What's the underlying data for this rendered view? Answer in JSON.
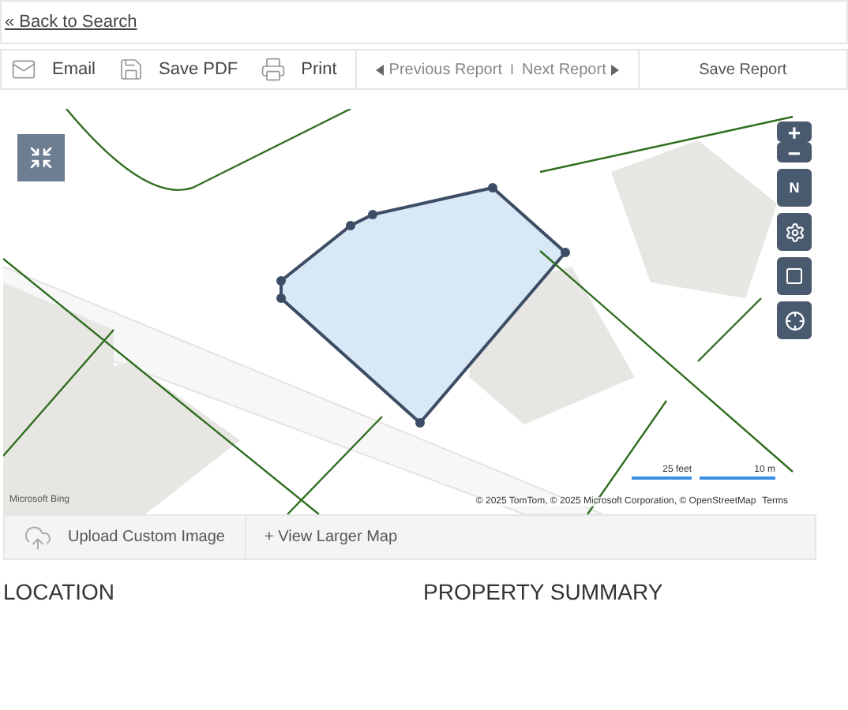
{
  "back_link": "« Back to Search",
  "toolbar": {
    "actions": [
      {
        "kind": "email",
        "label": "Email"
      },
      {
        "kind": "pdf",
        "label": "Save PDF"
      },
      {
        "kind": "print",
        "label": "Print"
      }
    ],
    "prev": "Previous Report",
    "separator": "I",
    "next": "Next Report",
    "save": "Save Report"
  },
  "map": {
    "kind": "picture",
    "bing": "Microsoft Bing",
    "attribution": "© 2025 TomTom, © 2025 Microsoft Corporation, © OpenStreetMap",
    "terms": "Terms",
    "scale": [
      "25 feet",
      "10 m"
    ],
    "controls": [
      {
        "kind": "zoom-in",
        "label": "+"
      },
      {
        "kind": "zoom-out",
        "label": "−"
      },
      {
        "kind": "compass",
        "label": "N"
      },
      {
        "kind": "settings"
      },
      {
        "kind": "select"
      },
      {
        "kind": "locate"
      }
    ]
  },
  "map_footer": {
    "upload": "Upload Custom Image",
    "larger": "+ View Larger Map"
  },
  "sections": [
    "LOCATION",
    "PROPERTY SUMMARY"
  ]
}
